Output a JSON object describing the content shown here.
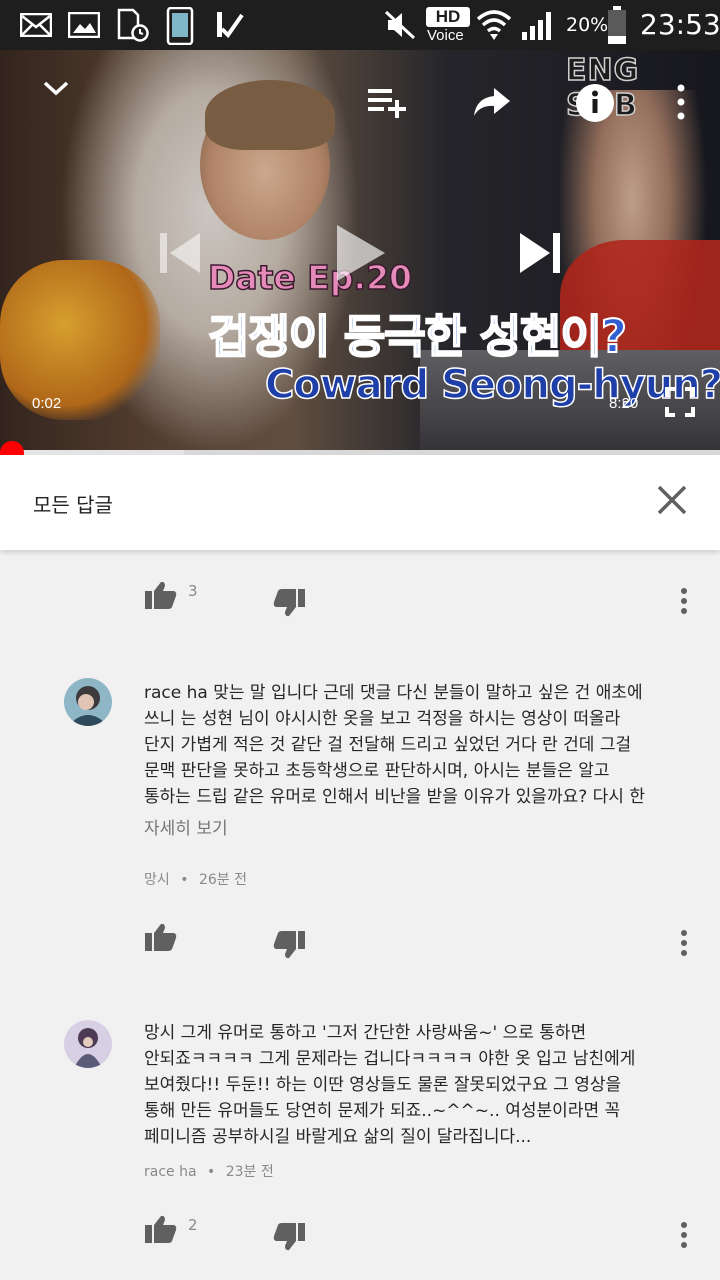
{
  "status_bar": {
    "hd_label": "HD",
    "voice_label": "Voice",
    "battery": "20%",
    "time": "23:53",
    "icons": [
      "mail-icon",
      "gallery-icon",
      "sim-clock-icon",
      "phone-icon",
      "check-icon",
      "mute-icon",
      "wifi-icon",
      "signal-icon",
      "battery-icon"
    ]
  },
  "player": {
    "overlay_line1": "Date Ep.20",
    "overlay_line2": "겁쟁이 등극한 성현이?",
    "overlay_line3": "Coward Seong-hyun?",
    "eng_sub": "ENG SUB",
    "current_time": "0:02",
    "duration": "8:20",
    "played_fraction": 0.004,
    "buffered_fraction": 0.255,
    "icons": [
      "chevron-down-icon",
      "add-to-playlist-icon",
      "share-icon",
      "info-icon",
      "more-vert-icon",
      "previous-icon",
      "play-icon",
      "next-icon",
      "fullscreen-icon"
    ]
  },
  "replies_panel": {
    "title": "모든 답글",
    "close_icon": "close-icon"
  },
  "comments": [
    {
      "like_count": "3"
    },
    {
      "text": "race ha 맞는 말 입니다 근데 댓글 다신 분들이 말하고 싶은 건 애초에\n쓰니 는 성현 님이 야시시한 옷을 보고 걱정을 하시는 영상이 떠올라\n단지 가볍게 적은 것 같단 걸 전달해 드리고 싶었던 거다 란 건데 그걸\n문맥 판단을 못하고 초등학생으로 판단하시며, 아시는 분들은 알고\n통하는 드립 같은 유머로 인해서 비난을 받을 이유가 있을까요? 다시 한",
      "read_more": "자세히 보기",
      "author": "망시",
      "separator": "•",
      "time_ago": "26분 전",
      "like_count": ""
    },
    {
      "text": "망시 그게 유머로 통하고 '그저 간단한 사랑싸움~' 으로 통하면\n안되죠ㅋㅋㅋㅋ 그게 문제라는 겁니다ㅋㅋㅋㅋ 야한 옷 입고 남친에게\n보여줬다!! 두둔!! 하는 이딴 영상들도 물론 잘못되었구요 그 영상을\n통해 만든 유머들도 당연히 문제가 되죠..~^^~.. 여성분이라면 꼭\n페미니즘 공부하시길 바랄게요 삶의 질이 달라집니다...",
      "author": "race ha",
      "separator": "•",
      "time_ago": "23분 전",
      "like_count": "2"
    }
  ],
  "colors": {
    "status_bar": "#1e1e1e",
    "progress_played": "#ff0000",
    "panel_bg": "#f1f1f1",
    "header_bg": "#ffffff",
    "icon_grey": "#606060"
  }
}
